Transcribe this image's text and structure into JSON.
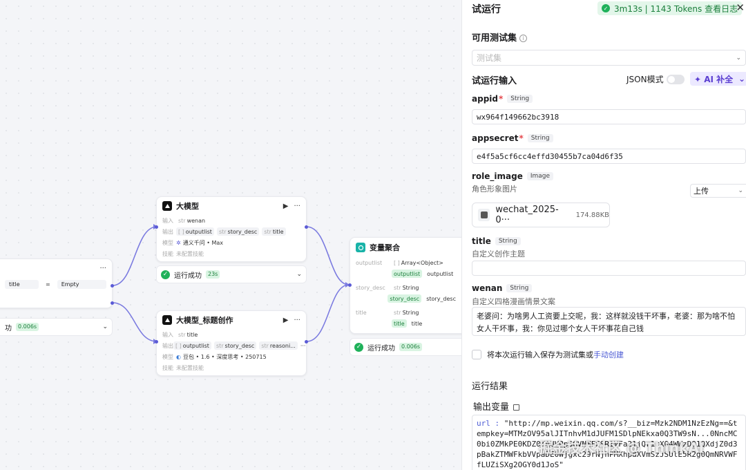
{
  "canvas": {
    "left_node": {
      "param_name": "title",
      "operator": "=",
      "value": "Empty",
      "status_text": "功",
      "time": "0.006s"
    },
    "llm_node": {
      "title": "大模型",
      "input_label": "输入",
      "input_value": "wenan",
      "output_label": "输出",
      "outputs": [
        "outputlist",
        "story_desc",
        "title"
      ],
      "model_label": "模型",
      "model_value": "通义千问 • Max",
      "skill_label": "技能",
      "skill_value": "未配置技能",
      "status_text": "运行成功",
      "time": "23s"
    },
    "title_node": {
      "title": "大模型_标题创作",
      "input_label": "输入",
      "input_value": "title",
      "output_label": "输出",
      "outputs": [
        "outputlist",
        "story_desc",
        "reasoni..."
      ],
      "more": "···",
      "model_label": "模型",
      "model_value": "豆包 • 1.6 • 深度思考 • 250715",
      "skill_label": "技能",
      "skill_value": "未配置技能"
    },
    "agg_node": {
      "title": "变量聚合",
      "rows": [
        {
          "name": "outputlist",
          "type": "Array<Object>",
          "chip1": "outputlist",
          "chip2": "outputlist"
        },
        {
          "name": "story_desc",
          "type": "String",
          "chip1": "story_desc",
          "chip2": "story_desc"
        },
        {
          "name": "title",
          "type": "String",
          "chip1": "title",
          "chip2": "title"
        }
      ],
      "status_text": "运行成功",
      "time": "0.006s"
    }
  },
  "panel": {
    "title": "试运行",
    "run_badge": "3m13s | 1143 Tokens  查看日志",
    "close": "✕",
    "testset_label": "可用测试集",
    "testset_placeholder": "测试集",
    "input_label": "试运行输入",
    "json_mode": "JSON模式",
    "ai_fill": "✦ AI 补全",
    "fields": {
      "appid": {
        "name": "appid",
        "type": "String",
        "value": "wx964f149662bc3918"
      },
      "appsecret": {
        "name": "appsecret",
        "type": "String",
        "value": "e4f5a5cf6cc4effd30455b7ca04d6f35"
      },
      "role_image": {
        "name": "role_image",
        "type": "Image",
        "desc": "角色形象图片",
        "upload": "上传",
        "file_name": "wechat_2025-0···",
        "file_size": "174.88KB"
      },
      "title": {
        "name": "title",
        "type": "String",
        "desc": "自定义创作主题",
        "value": ""
      },
      "wenan": {
        "name": "wenan",
        "type": "String",
        "desc": "自定义四格漫画情景文案",
        "value": "老婆问：为啥男人工资要上交呢，我：这样就没钱干坏事，老婆：那为啥不怕女人干坏事，我：你见过哪个女人干坏事花自己钱"
      }
    },
    "save_text": "将本次运行输入保存为测试集或",
    "save_link": "手动创建",
    "result_label": "运行结果",
    "output_var_label": "输出变量",
    "result_key": "url :",
    "result_value": " \"http://mp.weixin.qq.com/s?__biz=Mzk2NDM1NzEzNg==&tempkey=MTMzOV95alJITnhvM1dJUFM1SDlpNEkxa0Q3TW9sN...0NncMC0bi0ZMkPE0KDZ0KAUVBpSGVNMFFSR1VFa21jQr1rX04WWzDQ1QXdjZ0d3pBakZTMWFkbVVpaDE0Wjgxc29rNjhPMXhpdXVmSzJSUlE5R2g0QmNRVWFfLUZiSXg2OGY0d1JoS\""
  },
  "watermark": "掘金技术社区 @ ThinkAI"
}
